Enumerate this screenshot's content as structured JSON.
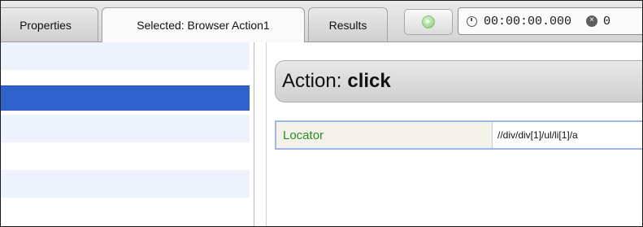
{
  "tabs": [
    {
      "label": "Properties",
      "active": false
    },
    {
      "label": "Selected: Browser Action1",
      "active": true
    },
    {
      "label": "Results",
      "active": false
    }
  ],
  "toolbar": {
    "run_icon": "play-circle-icon",
    "timer": "00:00:00.000",
    "error_count": "0",
    "error_icon_glyph": "×",
    "clock_icon": "clock-icon"
  },
  "list": {
    "selected_index": 1,
    "row_count": 6
  },
  "action": {
    "prefix": "Action:",
    "verb": "click"
  },
  "properties": [
    {
      "name": "Locator",
      "value": "//div/div[1]/ul/li[1]/a"
    }
  ],
  "colors": {
    "selection": "#2e61c9",
    "alt_row": "#eef2fc",
    "property_name": "#2d8a1f",
    "focus_border": "#9fb7e4"
  }
}
